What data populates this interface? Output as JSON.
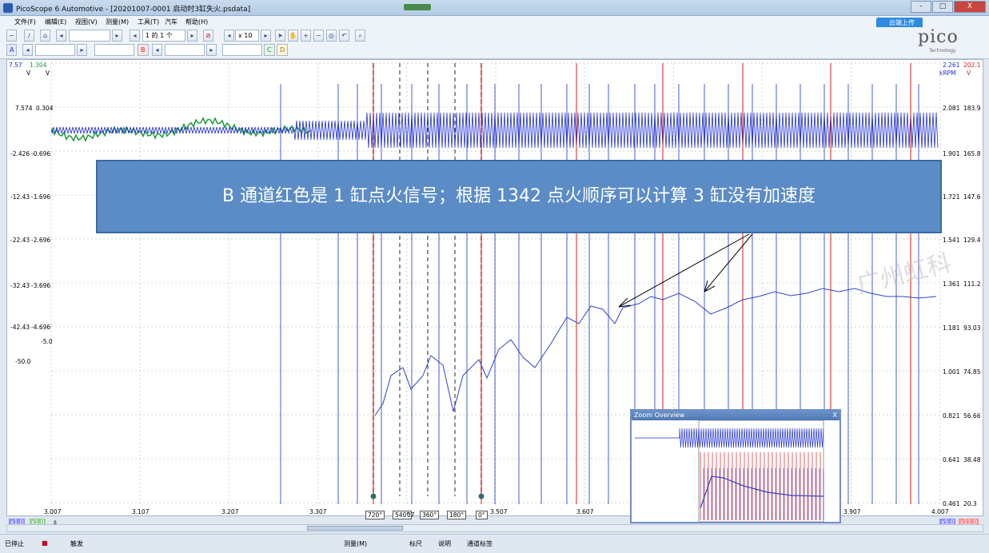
{
  "window": {
    "title": "PicoScope 6 Automotive - [20201007-0001 启动时3缸失火.psdata]",
    "buttons": [
      "-",
      "□",
      "X"
    ]
  },
  "menu": [
    "文件(F)",
    "编辑(E)",
    "视图(V)",
    "测量(M)",
    "工具(T)",
    "汽车",
    "帮助(H)"
  ],
  "toolbar": {
    "buffer_label": "1 的 1 个",
    "zoom_label": "x 10",
    "channel_a": "A",
    "channel_b": "B",
    "channel_c": "C",
    "channel_d": "D",
    "cloud_button": "云端上传"
  },
  "logo": {
    "text": "pico",
    "sub": "Technology"
  },
  "scope": {
    "top_left_a": "7.57",
    "top_left_b": "1.304",
    "unit_left_a": "V",
    "unit_left_b": "V",
    "top_right_a": "2.261",
    "top_right_b": "202.1",
    "unit_right_a": "kRPM",
    "unit_right_b": "V",
    "left_a_ticks": [
      "7.574",
      "-2.426",
      "-12.43",
      "-22.43",
      "-32.43",
      "-42.43"
    ],
    "left_b_ticks": [
      "0.304",
      "-0.696",
      "-1.696",
      "-2.696",
      "-3.696",
      "-4.696"
    ],
    "left_extra": [
      "-5.0",
      "-50.0"
    ],
    "right_rpm_ticks": [
      "2.081",
      "1.901",
      "1.721",
      "1.541",
      "1.361",
      "1.181",
      "1.001",
      "0.821",
      "0.641",
      "0.461"
    ],
    "right_v_ticks": [
      "183.9",
      "165.8",
      "147.6",
      "129.4",
      "111.2",
      "93.03",
      "74.85",
      "56.66",
      "38.48",
      "20.3"
    ],
    "x_ticks": [
      "3.007",
      "3.107",
      "3.207",
      "3.307",
      "3.407",
      "3.507",
      "3.607",
      "3.707",
      "3.807",
      "3.907",
      "4.007"
    ],
    "x_unit": "s",
    "x_scale_left_a": "x1.0",
    "x_scale_left_b": "x1.0",
    "x_scale_right_a": "x5.0",
    "x_scale_right_b": "x11.0",
    "rulers": [
      "720°",
      "540°",
      "360°",
      "180°",
      "0°"
    ],
    "ruler_overlap_text": "07",
    "zoom_overview_title": "Zoom Overview",
    "close_x": "X"
  },
  "callout": {
    "text": "B 通道红色是 1 缸点火信号；根据 1342 点火顺序可以计算 3 缸没有加速度"
  },
  "watermark": "广州虹科",
  "status": {
    "stopped": "已停止",
    "trigger": "触发",
    "measure": "测量(M)",
    "ruler": "标尺",
    "notes": "说明",
    "channel_labels": "通道标签"
  },
  "colors": {
    "channel_a": "#1f2fd1",
    "channel_b": "#d81e1e",
    "channel_c": "#1c9a3b",
    "math": "#2f43c9"
  }
}
